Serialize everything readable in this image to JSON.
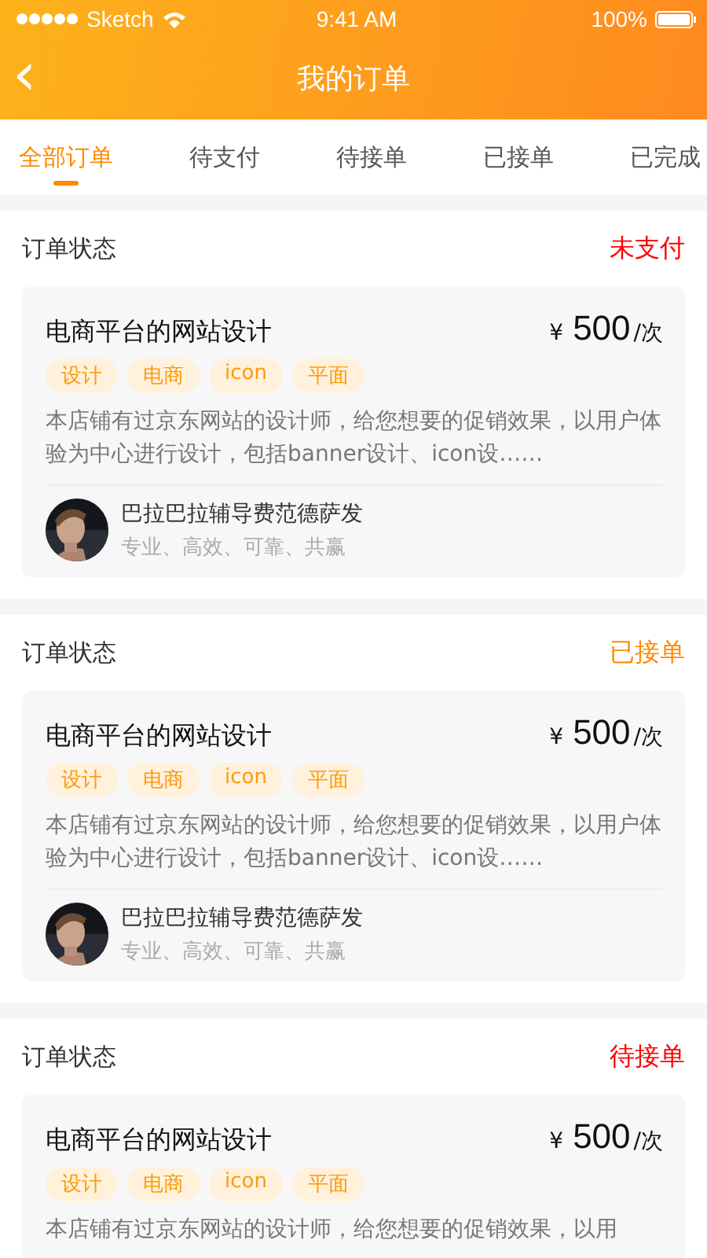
{
  "status_bar": {
    "carrier": "Sketch",
    "time": "9:41 AM",
    "battery": "100%"
  },
  "nav": {
    "back": "‹",
    "title": "我的订单"
  },
  "tabs": [
    {
      "label": "全部订单",
      "selected": true
    },
    {
      "label": "待支付",
      "selected": false
    },
    {
      "label": "待接单",
      "selected": false
    },
    {
      "label": "已接单",
      "selected": false
    },
    {
      "label": "已完成",
      "selected": false
    }
  ],
  "orders": [
    {
      "heading": "订单状态",
      "status": "未支付",
      "color": "#ff0000",
      "title": "电商平台的网站设计",
      "currency": "¥",
      "amount": "500",
      "unit": "/次",
      "tags": [
        "设计",
        "电商",
        "icon",
        "平面"
      ],
      "description": "本店铺有过京东网站的设计师，给您想要的促销效果，以用户体验为中心进行设计，包括banner设计、icon设……",
      "seller": {
        "name": "巴拉巴拉辅导费范德萨发",
        "motto": "专业、高效、可靠、共赢"
      }
    },
    {
      "heading": "订单状态",
      "status": "已接单",
      "color": "#ff8a00",
      "title": "电商平台的网站设计",
      "currency": "¥",
      "amount": "500",
      "unit": "/次",
      "tags": [
        "设计",
        "电商",
        "icon",
        "平面"
      ],
      "description": "本店铺有过京东网站的设计师，给您想要的促销效果，以用户体验为中心进行设计，包括banner设计、icon设……",
      "seller": {
        "name": "巴拉巴拉辅导费范德萨发",
        "motto": "专业、高效、可靠、共赢"
      }
    },
    {
      "heading": "订单状态",
      "status": "待接单",
      "color": "#ff0000",
      "title": "电商平台的网站设计",
      "currency": "¥",
      "amount": "500",
      "unit": "/次",
      "tags": [
        "设计",
        "电商",
        "icon",
        "平面"
      ],
      "description": "本店铺有过京东网站的设计师，给您想要的促销效果，以用"
    }
  ]
}
